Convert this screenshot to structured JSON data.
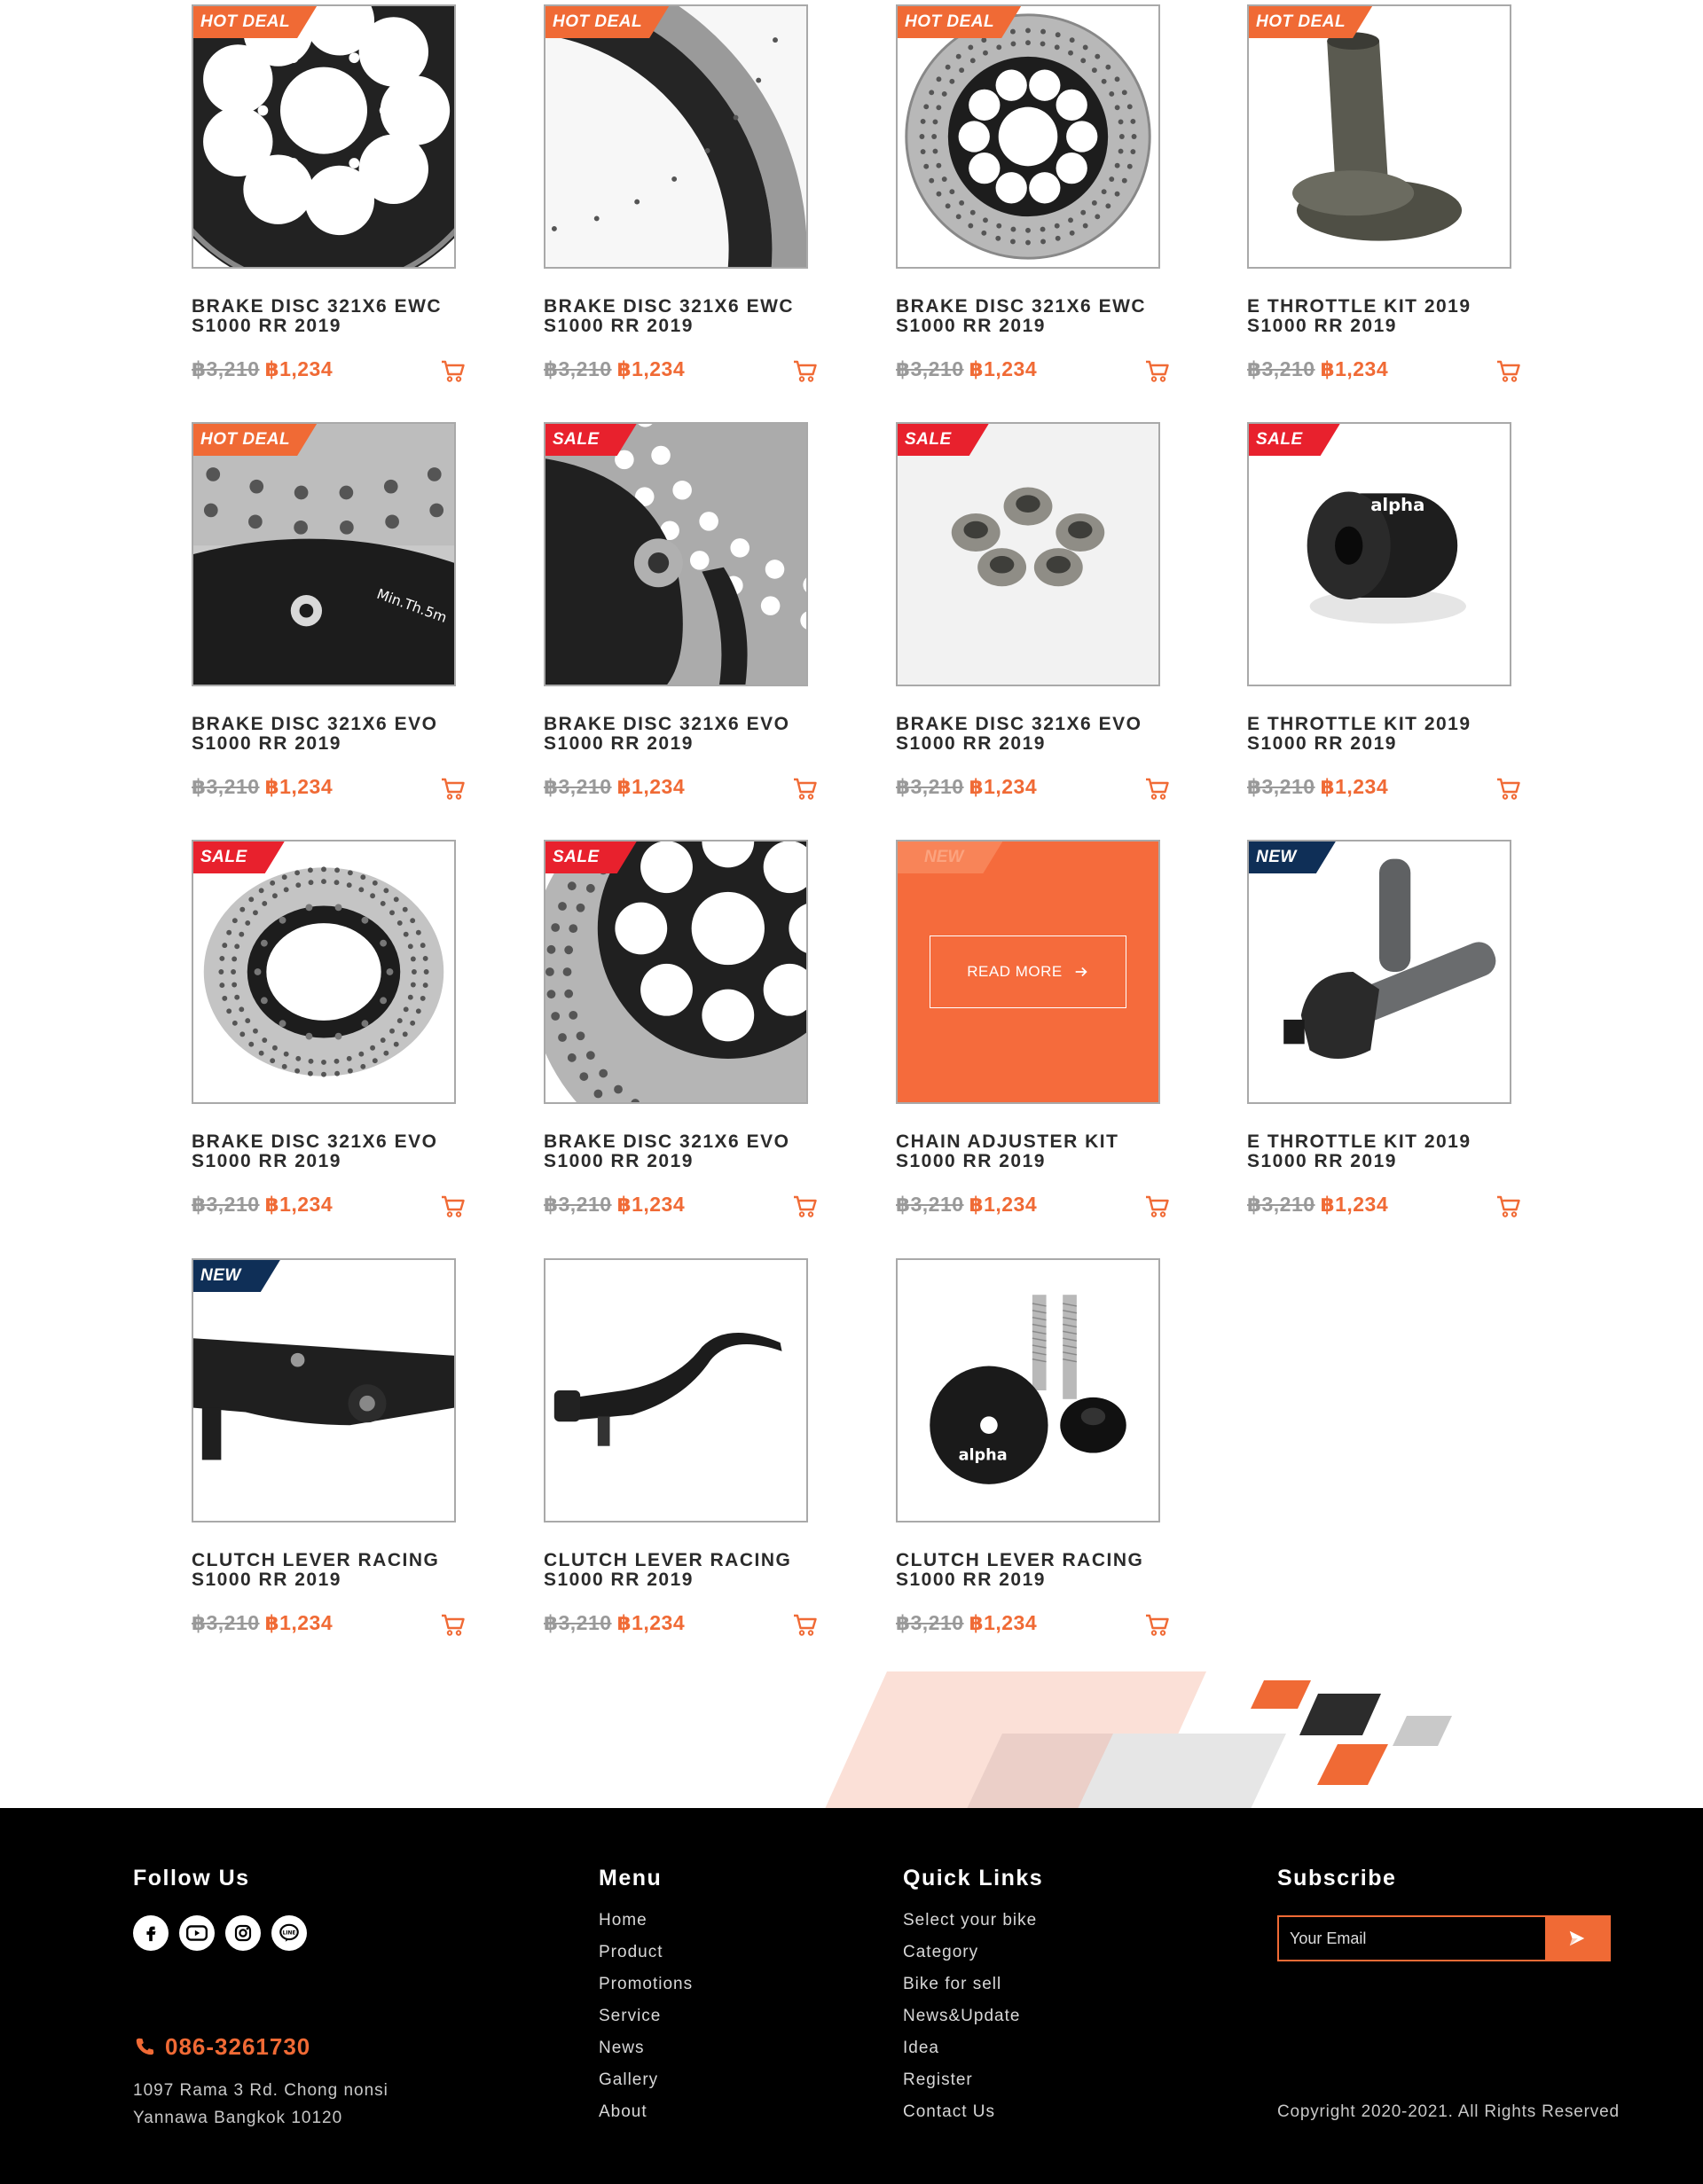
{
  "products": [
    {
      "badge": "HOT DEAL",
      "badge_type": "hot",
      "title1": "BRAKE DISC 321X6 EWC",
      "title2": "S1000 RR 2019",
      "old_price": "฿3,210",
      "price": "฿1,234",
      "image": "brake-disc-black-hub"
    },
    {
      "badge": "HOT DEAL",
      "badge_type": "hot",
      "title1": "BRAKE DISC 321X6 EWC",
      "title2": "S1000 RR 2019",
      "old_price": "฿3,210",
      "price": "฿1,234",
      "image": "brake-disc-rim-closeup"
    },
    {
      "badge": "HOT DEAL",
      "badge_type": "hot",
      "title1": "BRAKE DISC 321X6 EWC",
      "title2": "S1000 RR 2019",
      "old_price": "฿3,210",
      "price": "฿1,234",
      "image": "brake-disc-full"
    },
    {
      "badge": "HOT DEAL",
      "badge_type": "hot",
      "title1": "E THROTTLE KIT 2019",
      "title2": "S1000 RR 2019",
      "old_price": "฿3,210",
      "price": "฿1,234",
      "image": "throttle-cup"
    },
    {
      "badge": "HOT DEAL",
      "badge_type": "hot",
      "title1": "BRAKE DISC 321X6 EVO",
      "title2": "S1000 RR 2019",
      "old_price": "฿3,210",
      "price": "฿1,234",
      "image": "brake-disc-steel-closeup"
    },
    {
      "badge": "SALE",
      "badge_type": "sale",
      "title1": "BRAKE DISC 321X6 EVO",
      "title2": "S1000 RR 2019",
      "old_price": "฿3,210",
      "price": "฿1,234",
      "image": "brake-disc-carrier-closeup"
    },
    {
      "badge": "SALE",
      "badge_type": "sale",
      "title1": "BRAKE DISC 321X6 EVO",
      "title2": "S1000 RR 2019",
      "old_price": "฿3,210",
      "price": "฿1,234",
      "image": "bobbins-set"
    },
    {
      "badge": "SALE",
      "badge_type": "sale",
      "title1": "E THROTTLE KIT 2019",
      "title2": "S1000 RR 2019",
      "old_price": "฿3,210",
      "price": "฿1,234",
      "image": "spool-black"
    },
    {
      "badge": "SALE",
      "badge_type": "sale",
      "title1": "BRAKE DISC 321X6 EVO",
      "title2": "S1000 RR 2019",
      "old_price": "฿3,210",
      "price": "฿1,234",
      "image": "brake-disc-evo"
    },
    {
      "badge": "SALE",
      "badge_type": "sale",
      "title1": "BRAKE DISC 321X6 EVO",
      "title2": "S1000 RR 2019",
      "old_price": "฿3,210",
      "price": "฿1,234",
      "image": "brake-disc-angle"
    },
    {
      "badge": "NEW",
      "badge_type": "new",
      "title1": "CHAIN ADJUSTER KIT",
      "title2": "S1000 RR 2019",
      "old_price": "฿3,210",
      "price": "฿1,234",
      "image": "chain-adjuster",
      "hover_label": "READ MORE"
    },
    {
      "badge": "NEW",
      "badge_type": "new",
      "title1": "E THROTTLE KIT 2019",
      "title2": "S1000 RR 2019",
      "old_price": "฿3,210",
      "price": "฿1,234",
      "image": "throttle-grips"
    },
    {
      "badge": "NEW",
      "badge_type": "new",
      "title1": "CLUTCH LEVER RACING",
      "title2": "S1000 RR 2019",
      "old_price": "฿3,210",
      "price": "฿1,234",
      "image": "lever-closeup"
    },
    {
      "badge": "",
      "badge_type": "none",
      "title1": "CLUTCH LEVER RACING",
      "title2": "S1000 RR 2019",
      "old_price": "฿3,210",
      "price": "฿1,234",
      "image": "lever-full"
    },
    {
      "badge": "",
      "badge_type": "none",
      "title1": "CLUTCH LEVER RACING",
      "title2": "S1000 RR 2019",
      "old_price": "฿3,210",
      "price": "฿1,234",
      "image": "spools-bolts"
    }
  ],
  "footer": {
    "follow_heading": "Follow Us",
    "social": [
      "facebook-icon",
      "youtube-icon",
      "instagram-icon",
      "line-icon"
    ],
    "phone": "086-3261730",
    "address_line1": "1097 Rama 3 Rd. Chong nonsi",
    "address_line2": "Yannawa Bangkok 10120",
    "menu_heading": "Menu",
    "menu": [
      "Home",
      "Product",
      "Promotions",
      "Service",
      "News",
      "Gallery",
      "About"
    ],
    "quick_heading": "Quick Links",
    "quick": [
      "Select your bike",
      "Category",
      "Bike for sell",
      "News&Update",
      "Idea",
      "Register",
      "Contact Us"
    ],
    "subscribe_heading": "Subscribe",
    "email_placeholder": "Your Email",
    "copyright": "Copyright 2020-2021. All Rights Reserved"
  },
  "colors": {
    "accent": "#f06a35",
    "sale": "#e8212d",
    "new": "#0f2f57",
    "footer_bg": "#000000"
  }
}
